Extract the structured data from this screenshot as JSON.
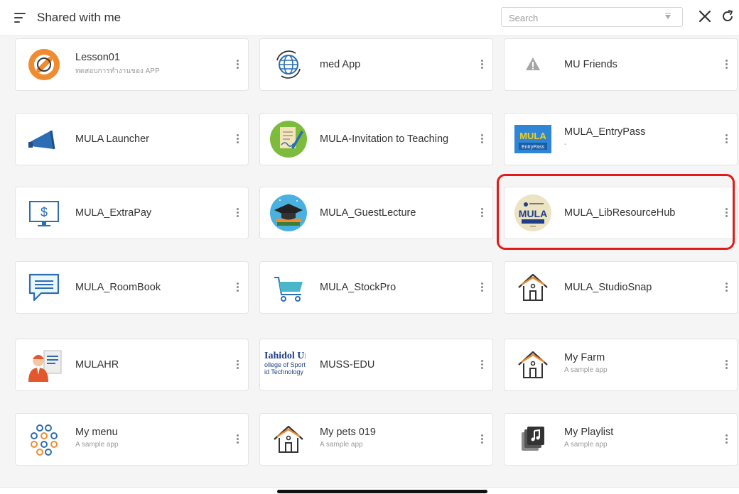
{
  "header": {
    "title": "Shared with me",
    "search_placeholder": "Search"
  },
  "apps": [
    {
      "title": "Lesson01",
      "subtitle": "ทดสอบการทำงานของ APP",
      "icon": "wrench-icon"
    },
    {
      "title": "med App",
      "subtitle": "",
      "icon": "globe-sync-icon"
    },
    {
      "title": "MU Friends",
      "subtitle": "",
      "icon": "warning-icon"
    },
    {
      "title": "MULA Launcher",
      "subtitle": "",
      "icon": "megaphone-icon"
    },
    {
      "title": "MULA-Invitation to Teaching",
      "subtitle": "",
      "icon": "signing-document-icon"
    },
    {
      "title": "MULA_EntryPass",
      "subtitle": "-",
      "icon": "mula-entrypass-logo",
      "logo_text": "MULA",
      "logo_sub": "EntryPass"
    },
    {
      "title": "MULA_ExtraPay",
      "subtitle": "",
      "icon": "dollar-monitor-icon"
    },
    {
      "title": "MULA_GuestLecture",
      "subtitle": "",
      "icon": "graduation-cap-icon"
    },
    {
      "title": "MULA_LibResourceHub",
      "subtitle": "",
      "icon": "mula-libresource-logo",
      "logo_text": "MULA"
    },
    {
      "title": "MULA_RoomBook",
      "subtitle": "",
      "icon": "chat-bubble-icon"
    },
    {
      "title": "MULA_StockPro",
      "subtitle": "",
      "icon": "shopping-cart-icon"
    },
    {
      "title": "MULA_StudioSnap",
      "subtitle": "",
      "icon": "house-icon"
    },
    {
      "title": "MULAHR",
      "subtitle": "",
      "icon": "person-document-icon"
    },
    {
      "title": "MUSS-EDU",
      "subtitle": "",
      "icon": "mahidol-logo",
      "logo_lines": [
        "Iahidol Ur",
        "ollege of Sport",
        "id Technology"
      ]
    },
    {
      "title": "My Farm",
      "subtitle": "A sample app",
      "icon": "house-icon"
    },
    {
      "title": "My menu",
      "subtitle": "A sample app",
      "icon": "circles-cluster-icon"
    },
    {
      "title": "My pets 019",
      "subtitle": "A sample app",
      "icon": "house-icon"
    },
    {
      "title": "My Playlist",
      "subtitle": "A sample app",
      "icon": "music-stack-icon"
    }
  ],
  "colors": {
    "highlight": "#e51919",
    "accent_blue": "#2c6db5",
    "icon_teal": "#49b7c9",
    "icon_orange": "#f08b2f"
  }
}
